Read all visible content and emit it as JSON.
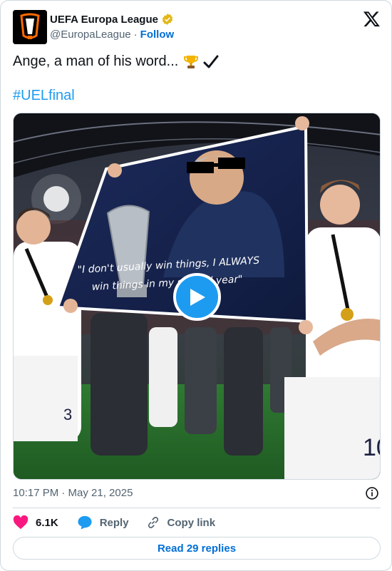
{
  "author": {
    "name": "UEFA Europa League",
    "handle": "@EuropaLeague",
    "separator": "·",
    "follow_label": "Follow"
  },
  "tweet": {
    "text": "Ange, a man of his word...",
    "emojis": [
      "trophy-icon",
      "check-mark-icon"
    ],
    "hashtag": "#UELfinal"
  },
  "media": {
    "type": "video",
    "banner_quote": "\"I don't usually win things, I ALWAYS win things in my second year\""
  },
  "timestamp": "10:17 PM · May 21, 2025",
  "actions": {
    "likes": "6.1K",
    "reply_label": "Reply",
    "copy_label": "Copy link"
  },
  "read_replies_label": "Read 29 replies",
  "colors": {
    "link": "#006fd6",
    "hashtag": "#1d9bf0",
    "heart": "#f91880",
    "reply_bubble": "#1d9bf0",
    "verified_gold": "#e2b719"
  }
}
